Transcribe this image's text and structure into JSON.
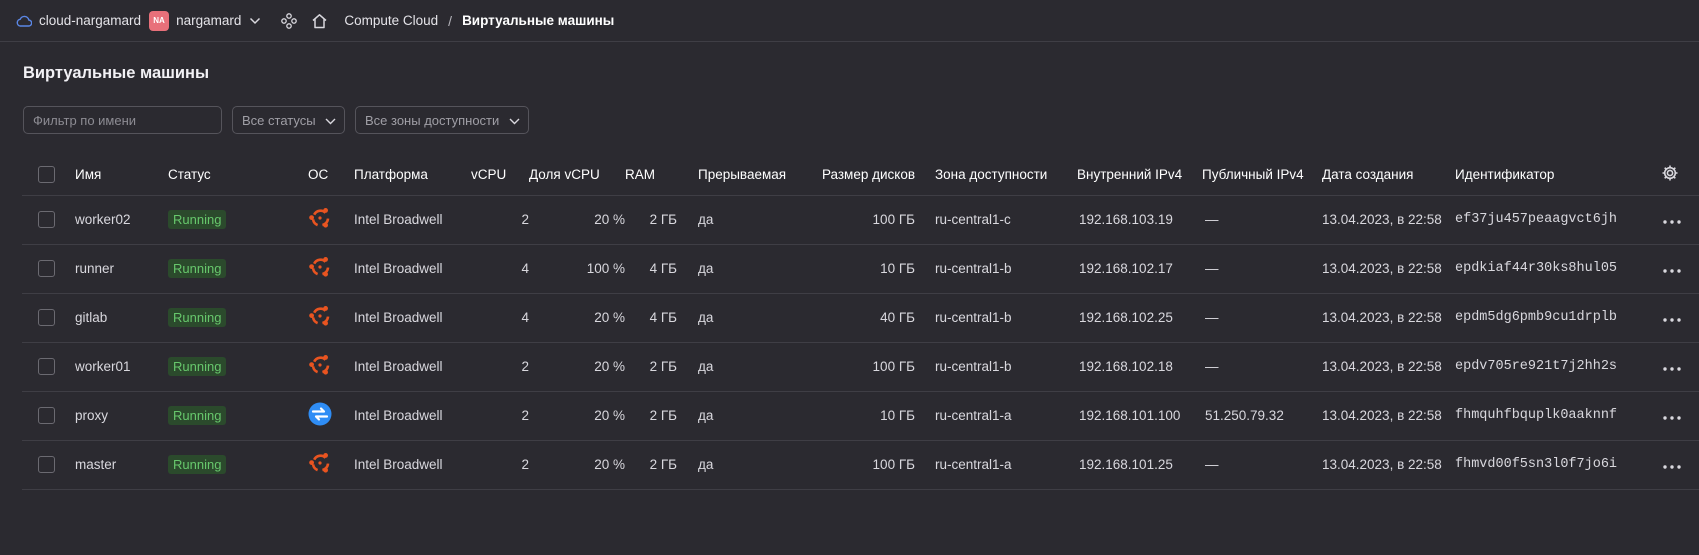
{
  "topbar": {
    "cloud_name": "cloud-nargamard",
    "avatar_initials": "NA",
    "folder_name": "nargamard",
    "breadcrumb_service": "Compute Cloud",
    "breadcrumb_separator": "/",
    "breadcrumb_current": "Виртуальные машины"
  },
  "page": {
    "title": "Виртуальные машины"
  },
  "filters": {
    "name_placeholder": "Фильтр по имени",
    "status_select": "Все статусы",
    "zone_select": "Все зоны доступности"
  },
  "table": {
    "columns": {
      "name": "Имя",
      "status": "Статус",
      "os": "ОС",
      "platform": "Платформа",
      "vcpu": "vCPU",
      "vcpu_share": "Доля vCPU",
      "ram": "RAM",
      "preemptible": "Прерываемая",
      "disk_size": "Размер дисков",
      "zone": "Зона доступности",
      "internal_ip": "Внутренний IPv4",
      "public_ip": "Публичный IPv4",
      "created": "Дата создания",
      "id": "Идентификатор"
    },
    "rows": [
      {
        "name": "worker02",
        "status": "Running",
        "os": "ubuntu-icon",
        "platform": "Intel Broadwell",
        "vcpu": "2",
        "vcpu_share": "20 %",
        "ram": "2 ГБ",
        "preemptible": "да",
        "disk_size": "100 ГБ",
        "zone": "ru-central1-c",
        "internal_ip": "192.168.103.19",
        "public_ip": "—",
        "created": "13.04.2023, в 22:58",
        "id": "ef37ju457peaagvct6jh"
      },
      {
        "name": "runner",
        "status": "Running",
        "os": "ubuntu-icon",
        "platform": "Intel Broadwell",
        "vcpu": "4",
        "vcpu_share": "100 %",
        "ram": "4 ГБ",
        "preemptible": "да",
        "disk_size": "10 ГБ",
        "zone": "ru-central1-b",
        "internal_ip": "192.168.102.17",
        "public_ip": "—",
        "created": "13.04.2023, в 22:58",
        "id": "epdkiaf44r30ks8hul05"
      },
      {
        "name": "gitlab",
        "status": "Running",
        "os": "ubuntu-icon",
        "platform": "Intel Broadwell",
        "vcpu": "4",
        "vcpu_share": "20 %",
        "ram": "4 ГБ",
        "preemptible": "да",
        "disk_size": "40 ГБ",
        "zone": "ru-central1-b",
        "internal_ip": "192.168.102.25",
        "public_ip": "—",
        "created": "13.04.2023, в 22:58",
        "id": "epdm5dg6pmb9cu1drplb"
      },
      {
        "name": "worker01",
        "status": "Running",
        "os": "ubuntu-icon",
        "platform": "Intel Broadwell",
        "vcpu": "2",
        "vcpu_share": "20 %",
        "ram": "2 ГБ",
        "preemptible": "да",
        "disk_size": "100 ГБ",
        "zone": "ru-central1-b",
        "internal_ip": "192.168.102.18",
        "public_ip": "—",
        "created": "13.04.2023, в 22:58",
        "id": "epdv705re921t7j2hh2s"
      },
      {
        "name": "proxy",
        "status": "Running",
        "os": "nat-instance-icon",
        "platform": "Intel Broadwell",
        "vcpu": "2",
        "vcpu_share": "20 %",
        "ram": "2 ГБ",
        "preemptible": "да",
        "disk_size": "10 ГБ",
        "zone": "ru-central1-a",
        "internal_ip": "192.168.101.100",
        "public_ip": "51.250.79.32",
        "created": "13.04.2023, в 22:58",
        "id": "fhmquhfbquplk0aaknnf"
      },
      {
        "name": "master",
        "status": "Running",
        "os": "ubuntu-icon",
        "platform": "Intel Broadwell",
        "vcpu": "2",
        "vcpu_share": "20 %",
        "ram": "2 ГБ",
        "preemptible": "да",
        "disk_size": "100 ГБ",
        "zone": "ru-central1-a",
        "internal_ip": "192.168.101.25",
        "public_ip": "—",
        "created": "13.04.2023, в 22:58",
        "id": "fhmvd00f5sn3l0f7jo6i"
      }
    ]
  },
  "colors": {
    "background": "#2b2a30",
    "status_running_text": "#67c76c",
    "status_running_bg": "#2b4a2c",
    "ubuntu_orange": "#e95420",
    "nat_blue": "#2f8df5",
    "avatar_pink": "#e8707a"
  }
}
